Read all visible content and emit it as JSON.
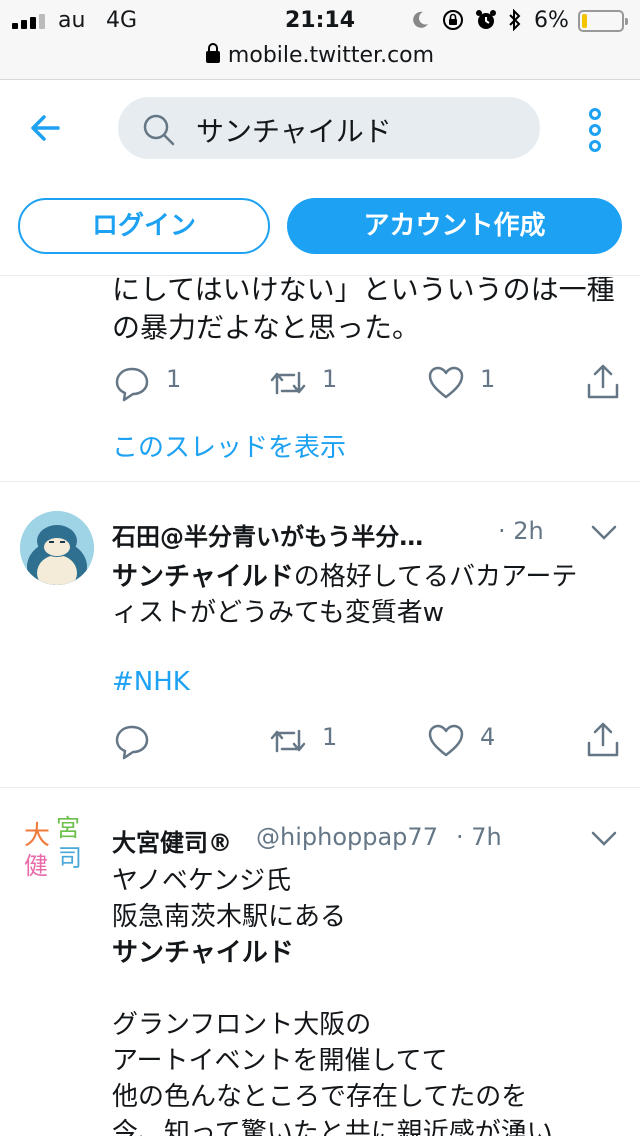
{
  "status_bar": {
    "carrier": "au",
    "network": "4G",
    "time": "21:14",
    "battery": "6%",
    "battery_level": 0.06
  },
  "url_bar": {
    "url": "mobile.twitter.com"
  },
  "header": {
    "search_query": "サンチャイルド",
    "login_label": "ログイン",
    "signup_label": "アカウント作成"
  },
  "tweets": [
    {
      "lines": [
        "にしてはいけない」といういうのは一種",
        "の暴力だよなと思った。"
      ],
      "replies": "1",
      "retweets": "1",
      "likes": "1",
      "thread_link": "このスレッドを表示"
    },
    {
      "name": "石田@半分青いがもう半分…",
      "time": "· 2h",
      "bold_lead": "サンチャイルド",
      "line1_rest": "の格好してるバカアーテ",
      "line2": "ィストがどうみても変質者w",
      "hashtag": "#NHK",
      "replies": "",
      "retweets": "1",
      "likes": "4"
    },
    {
      "name": "大宮健司®",
      "handle": "@hiphoppap77",
      "time": "· 7h",
      "avatar_text": [
        "大",
        "宮",
        "健",
        "司"
      ],
      "lines": [
        "ヤノベケンジ氏",
        "阪急南茨木駅にある"
      ],
      "bold_line": "サンチャイルド",
      "lines2": [
        "グランフロント大阪の",
        "アートイベントを開催してて",
        "他の色んなところで存在してたのを",
        "今、知って驚いたと共に親近感が湧い"
      ]
    }
  ],
  "colors": {
    "accent": "#1da1f2",
    "muted": "#657786",
    "text": "#14171a",
    "divider": "#e6ecf0"
  }
}
